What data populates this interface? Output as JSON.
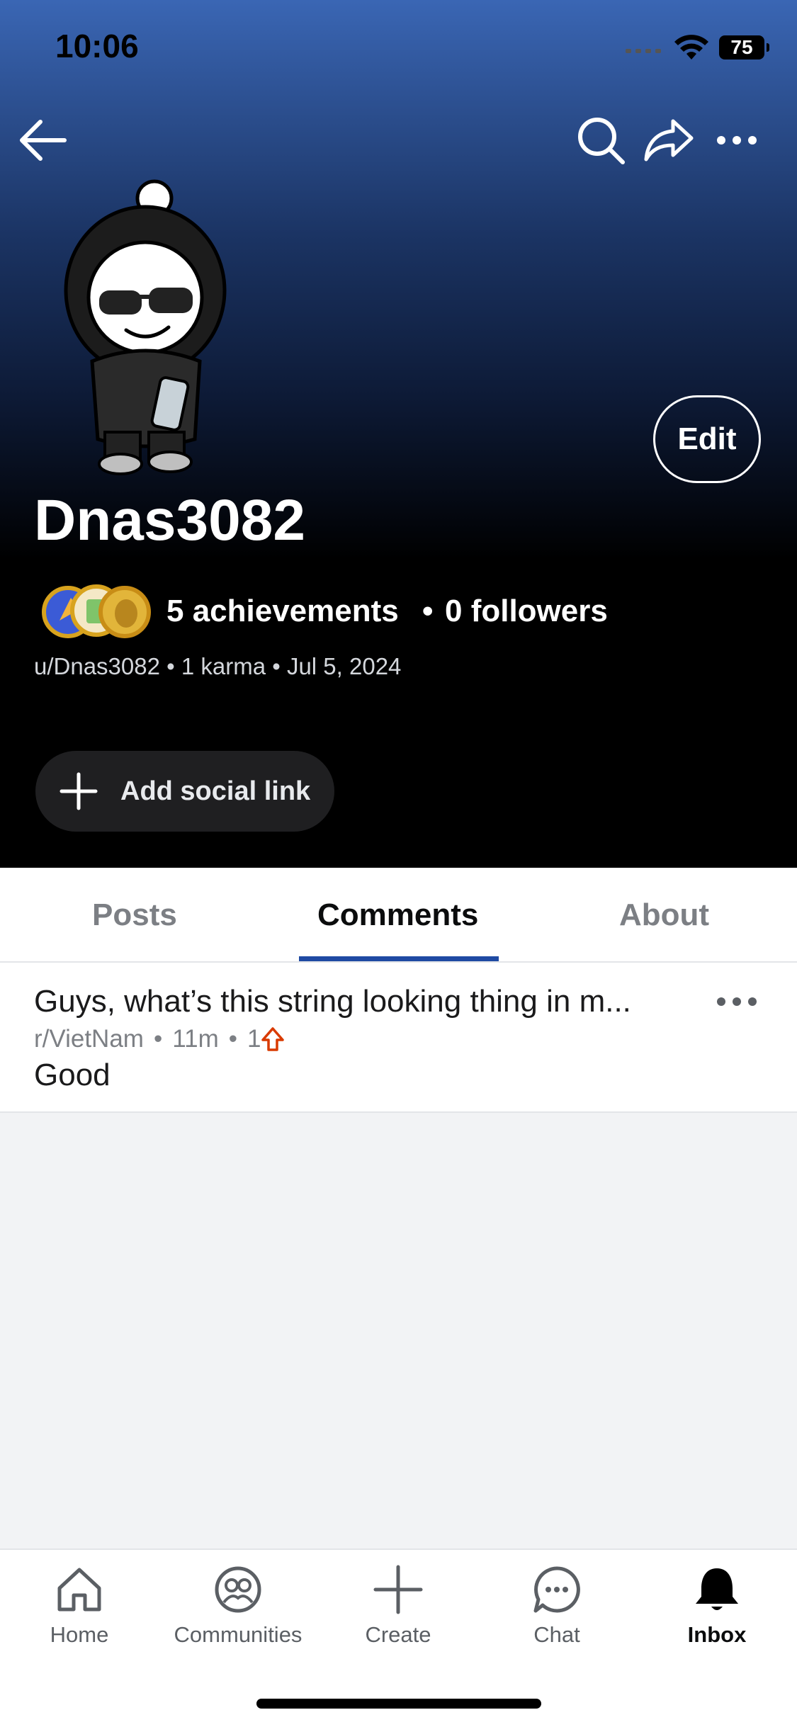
{
  "status_bar": {
    "time": "10:06",
    "battery": "75"
  },
  "profile": {
    "username": "Dnas3082",
    "edit_label": "Edit",
    "achievements": "5 achievements",
    "separator": "•",
    "followers": "0 followers",
    "meta": "u/Dnas3082 • 1 karma • Jul 5, 2024",
    "add_social_label": "Add social link"
  },
  "tabs": [
    {
      "label": "Posts",
      "active": false
    },
    {
      "label": "Comments",
      "active": true
    },
    {
      "label": "About",
      "active": false
    }
  ],
  "comments": [
    {
      "title": "Guys, what’s this string looking thing in m...",
      "subreddit": "r/VietNam",
      "age": "11m",
      "votes": "1",
      "body": "Good"
    }
  ],
  "nav": [
    {
      "label": "Home",
      "icon": "home-icon"
    },
    {
      "label": "Communities",
      "icon": "communities-icon"
    },
    {
      "label": "Create",
      "icon": "plus-icon"
    },
    {
      "label": "Chat",
      "icon": "chat-icon"
    },
    {
      "label": "Inbox",
      "icon": "bell-icon",
      "active": true
    }
  ],
  "colors": {
    "accent": "#1f4aa3",
    "upvote": "#d93a00",
    "header_top": "#3a66b4"
  }
}
